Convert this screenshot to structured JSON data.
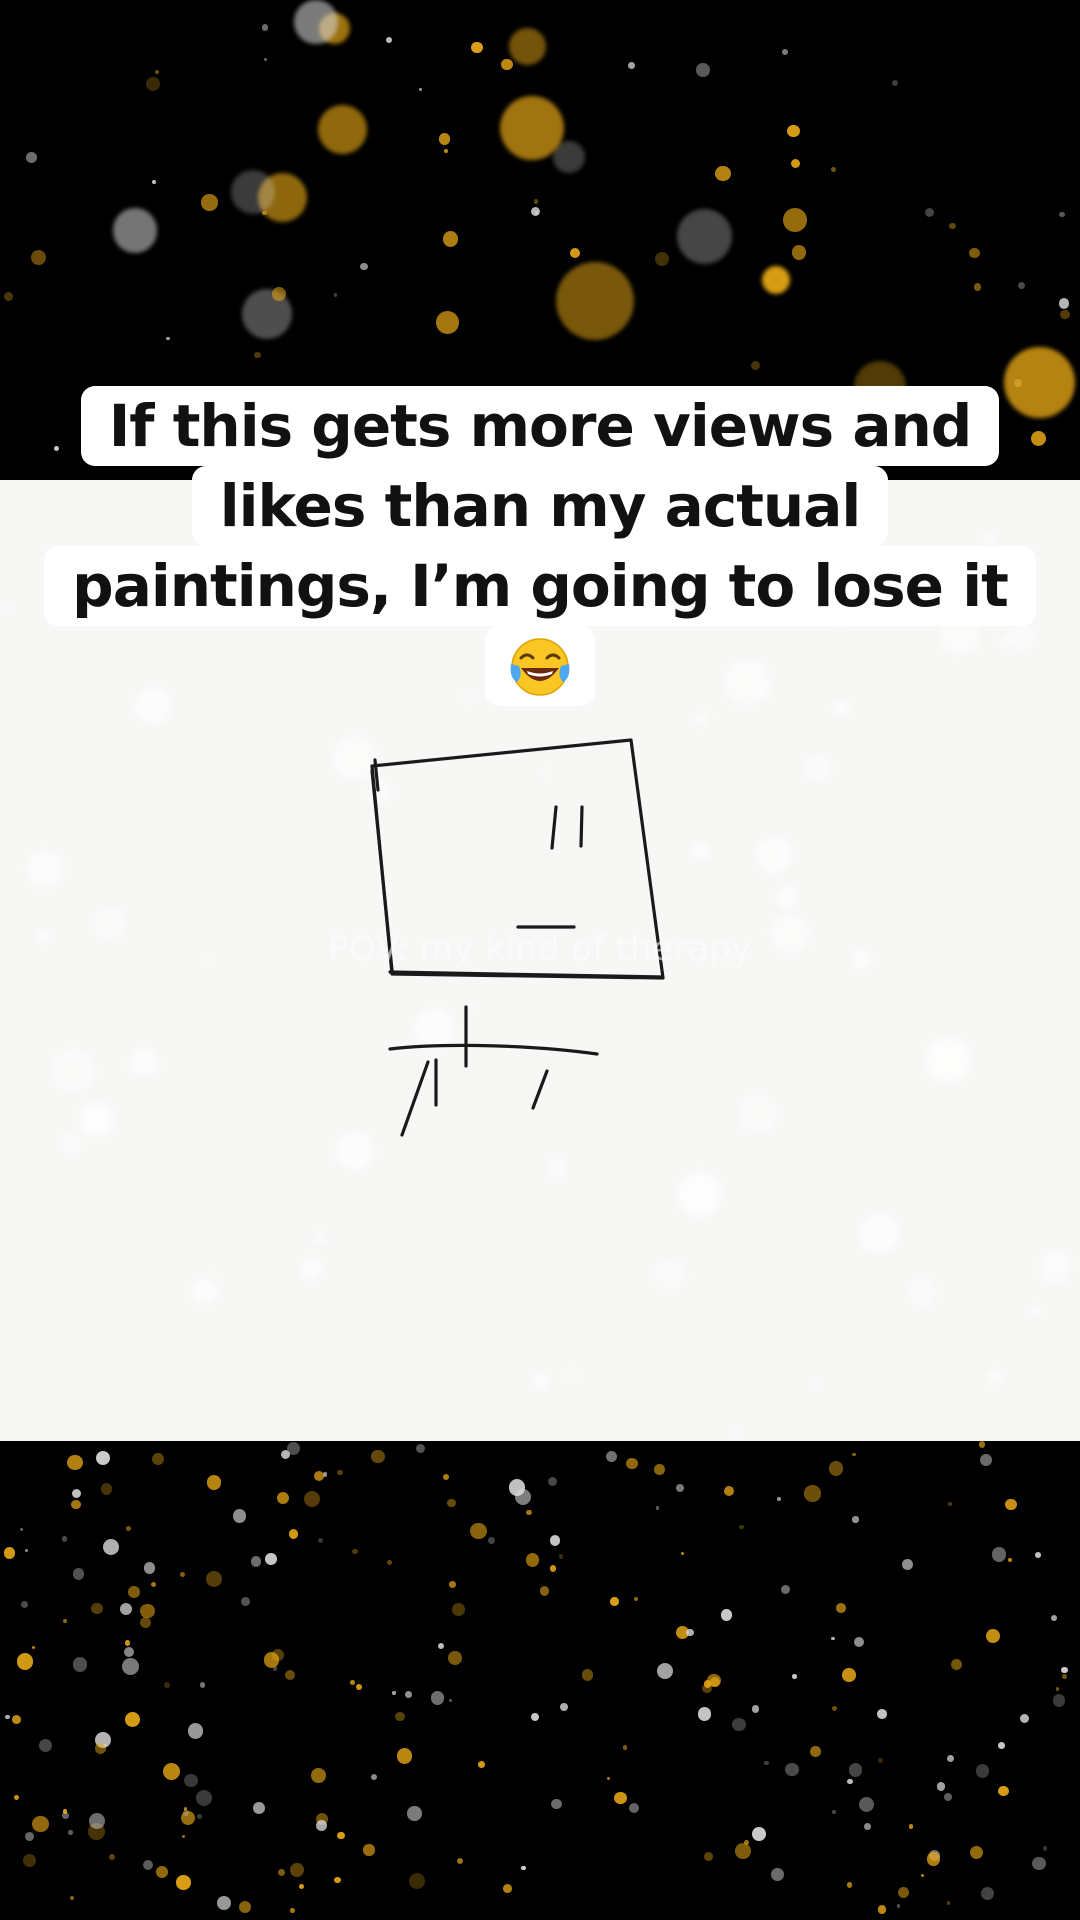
{
  "caption": {
    "lines": [
      "If this gets more views and",
      "likes  than my actual",
      "paintings, I’m going to lose it"
    ],
    "emoji": "face-with-tears-of-joy"
  },
  "watermark_text": "POV: my kind of therapy",
  "colors": {
    "background": "#000000",
    "board": "#f7f7f6",
    "caption_bg": "#ffffff",
    "caption_text": "#111111",
    "bokeh_gold": "#e8a816",
    "bokeh_white": "#d8d8d8",
    "ink": "#1a1a1a"
  }
}
